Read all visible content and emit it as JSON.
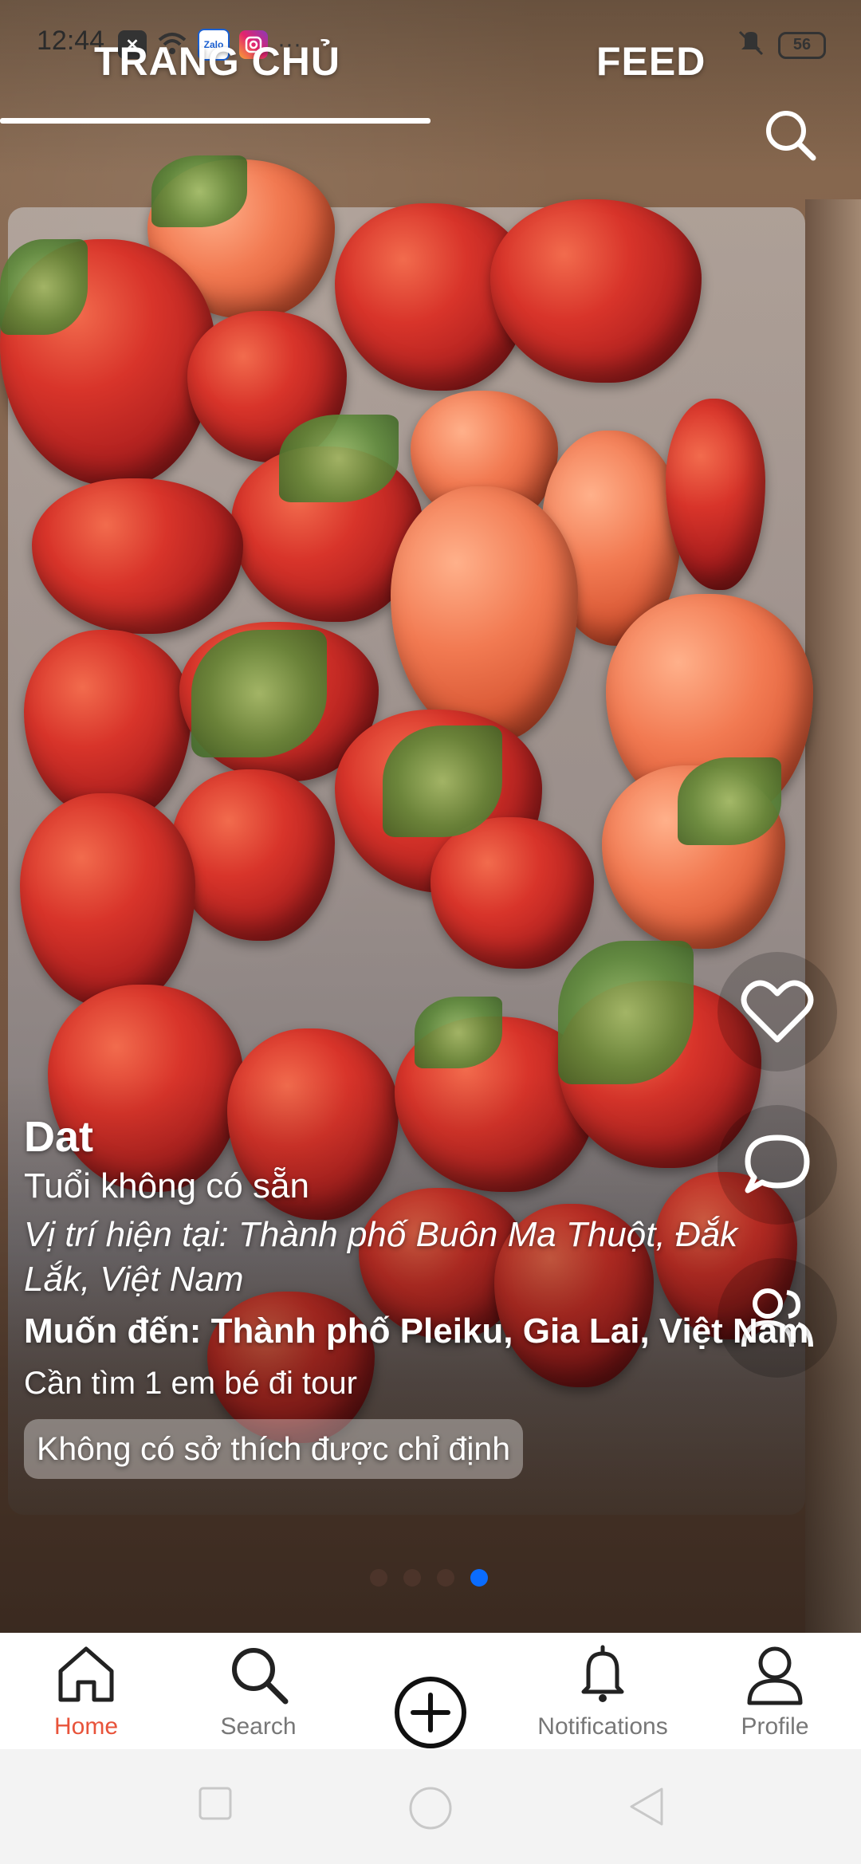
{
  "status_bar": {
    "time": "12:44",
    "more": "···",
    "battery": "56",
    "icons": [
      "close-notification-icon",
      "wifi-icon",
      "zalo-icon",
      "instagram-icon",
      "vibrate-icon",
      "battery-icon"
    ]
  },
  "tabs": {
    "home": "TRANG CHỦ",
    "feed": "FEED"
  },
  "post": {
    "name": "Dat",
    "age": "Tuổi không có sẵn",
    "location": "Vị trí hiện tại: Thành phố Buôn Ma Thuột, Đắk Lắk, Việt Nam",
    "destination": "Muốn đến: Thành phố Pleiku, Gia Lai, Việt Nam",
    "description": "Cần tìm 1 em bé đi tour",
    "interests": "Không có sở thích được chỉ định"
  },
  "pagination": {
    "total": 4,
    "active_index": 4
  },
  "bottom_nav": {
    "home": "Home",
    "search": "Search",
    "notifications": "Notifications",
    "profile": "Profile"
  },
  "colors": {
    "accent": "#e8533a",
    "dot_active": "#0a6cff"
  }
}
